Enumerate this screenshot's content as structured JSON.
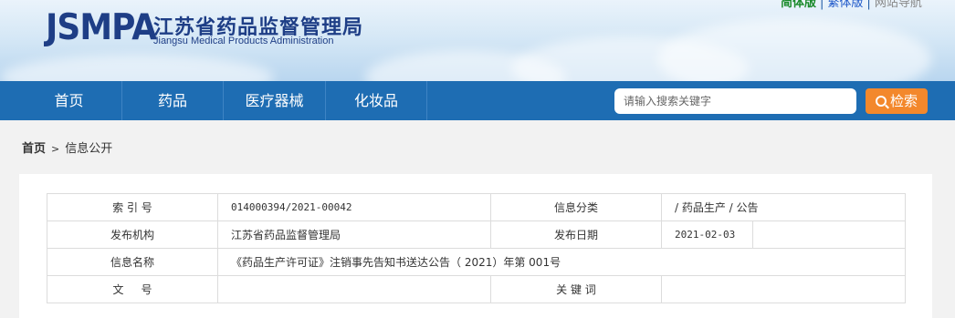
{
  "header": {
    "logo_mark": "JSMPA",
    "logo_cn": "江苏省药品监督管理局",
    "logo_en": "Jiangsu Medical Products Administration",
    "top_links": [
      "简体版",
      "繁体版",
      "网站导航"
    ]
  },
  "nav": {
    "items": [
      "首页",
      "药品",
      "医疗器械",
      "化妆品"
    ]
  },
  "search": {
    "placeholder": "请输入搜索关键字",
    "button_label": "检索"
  },
  "breadcrumb": {
    "home": "首页",
    "separator": ">",
    "current": "信息公开"
  },
  "info_table": {
    "index_label": "索 引 号",
    "index_value": "014000394/2021-00042",
    "category_label": "信息分类",
    "category_value": "/ 药品生产 / 公告",
    "publisher_label": "发布机构",
    "publisher_value": "江苏省药品监督管理局",
    "date_label": "发布日期",
    "date_value": "2021-02-03",
    "name_label": "信息名称",
    "name_value": "《药品生产许可证》注销事先告知书送达公告（ 2021）年第 001号",
    "docno_label": "文     号",
    "docno_value": "",
    "keywords_label": "关 键 词",
    "keywords_value": ""
  },
  "colors": {
    "nav_bg": "#1e6db3",
    "search_button": "#f3882c",
    "logo_blue": "#1e3e86",
    "page_bg": "#f2f2f2"
  }
}
